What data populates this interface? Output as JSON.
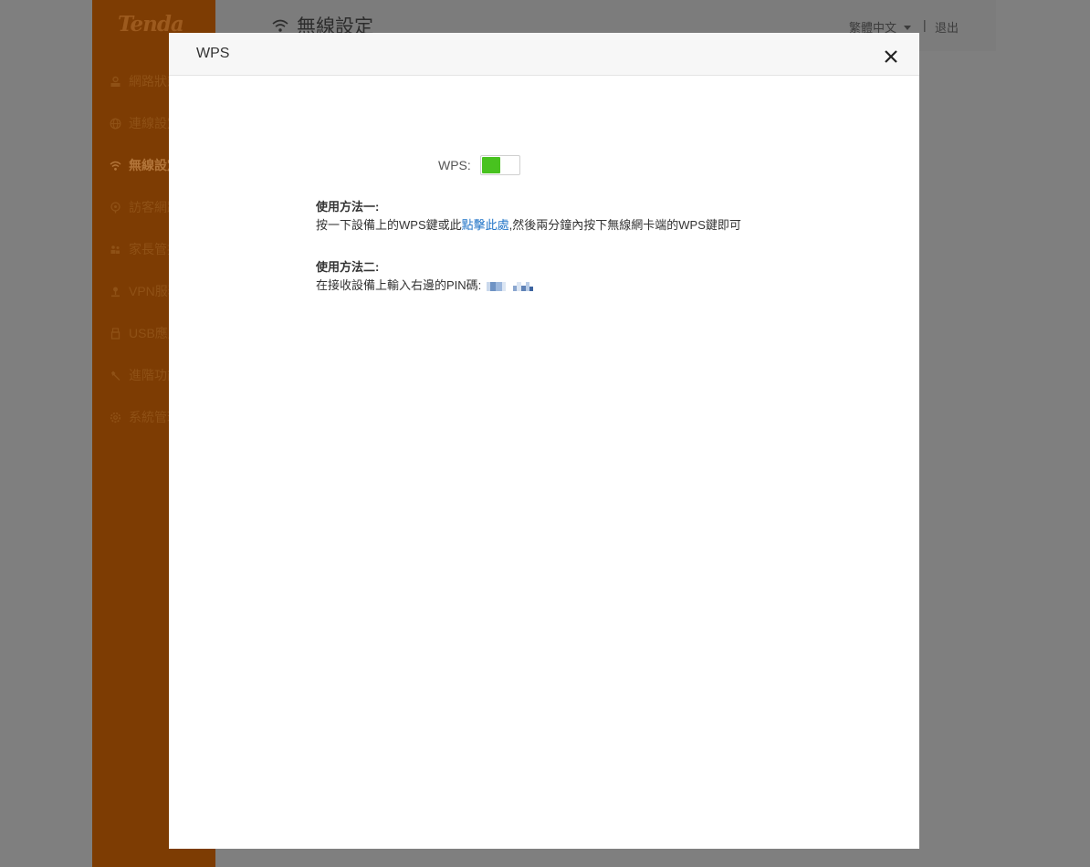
{
  "app": {
    "logo": "Tenda",
    "page_title": "無線設定",
    "language": "繁體中文",
    "separator": "|",
    "logout": "退出"
  },
  "sidebar": {
    "items": [
      {
        "label": "網路狀態",
        "icon": "router-status-icon",
        "active": false
      },
      {
        "label": "連線設定",
        "icon": "globe-icon",
        "active": false
      },
      {
        "label": "無線設定",
        "icon": "wifi-icon",
        "active": true
      },
      {
        "label": "訪客網路",
        "icon": "guest-network-icon",
        "active": false
      },
      {
        "label": "家長管控",
        "icon": "parental-control-icon",
        "active": false
      },
      {
        "label": "VPN服務",
        "icon": "vpn-icon",
        "active": false
      },
      {
        "label": "USB應用",
        "icon": "usb-icon",
        "active": false
      },
      {
        "label": "進階功能",
        "icon": "wrench-icon",
        "active": false
      },
      {
        "label": "系統管理",
        "icon": "gear-icon",
        "active": false
      }
    ]
  },
  "modal": {
    "title": "WPS",
    "wps_label": "WPS:",
    "wps_enabled": true,
    "method1": {
      "title": "使用方法一:",
      "desc_before": "按一下設備上的WPS鍵或此",
      "link": "點擊此處",
      "desc_after": ",然後兩分鐘內按下無線網卡端的WPS鍵即可"
    },
    "method2": {
      "title": "使用方法二:",
      "desc": "在接收設備上輸入右邊的PIN碼:"
    }
  },
  "colors": {
    "sidebar_bg": "#7d3c03",
    "toggle_on": "#48c21f",
    "link": "#1f73c7",
    "overlay": "#7f7f7f"
  }
}
